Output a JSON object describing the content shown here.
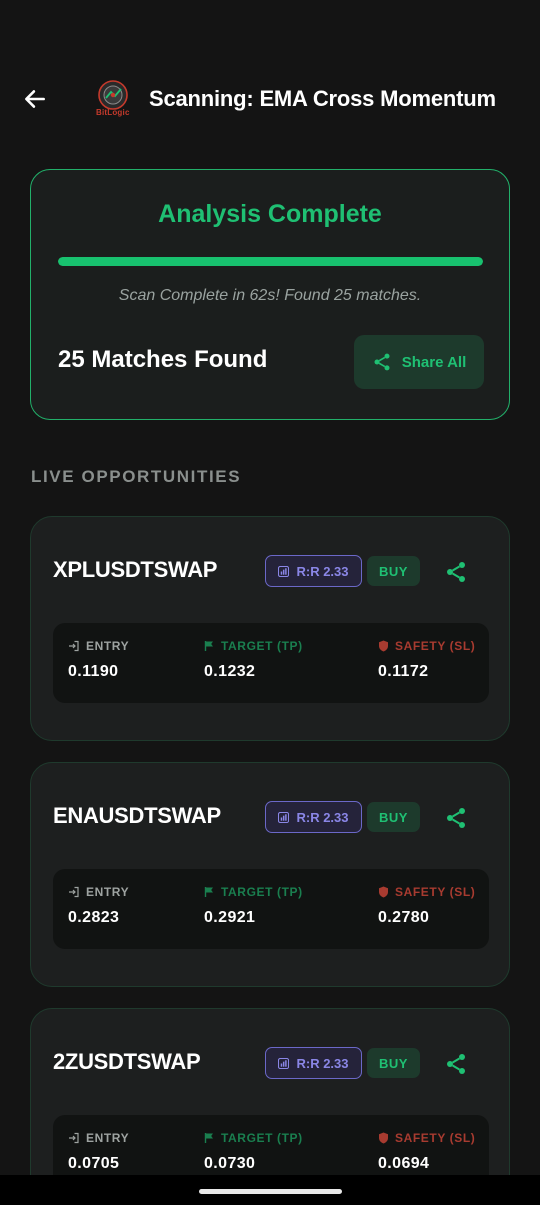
{
  "header": {
    "title": "Scanning: EMA Cross Momentum",
    "logo_text": "BitLogic",
    "back_icon": "arrow-left-icon"
  },
  "status": {
    "title": "Analysis Complete",
    "progress_fraction": 1.0,
    "message": "Scan Complete in 62s! Found 25 matches.",
    "matches_text": "25 Matches Found",
    "share_all_label": "Share All"
  },
  "section": {
    "label": "LIVE OPPORTUNITIES"
  },
  "labels": {
    "entry": "ENTRY",
    "target": "TARGET (TP)",
    "safety": "SAFETY (SL)"
  },
  "colors": {
    "accent_green": "#1fc073",
    "rr_purple": "#8a86e6",
    "safety_red": "#a83b30",
    "background": "#141414"
  },
  "cards": [
    {
      "symbol": "XPLUSDTSWAP",
      "rr": "R:R 2.33",
      "side": "BUY",
      "entry": "0.1190",
      "target": "0.1232",
      "safety": "0.1172"
    },
    {
      "symbol": "ENAUSDTSWAP",
      "rr": "R:R 2.33",
      "side": "BUY",
      "entry": "0.2823",
      "target": "0.2921",
      "safety": "0.2780"
    },
    {
      "symbol": "2ZUSDTSWAP",
      "rr": "R:R 2.33",
      "side": "BUY",
      "entry": "0.0705",
      "target": "0.0730",
      "safety": "0.0694"
    }
  ]
}
